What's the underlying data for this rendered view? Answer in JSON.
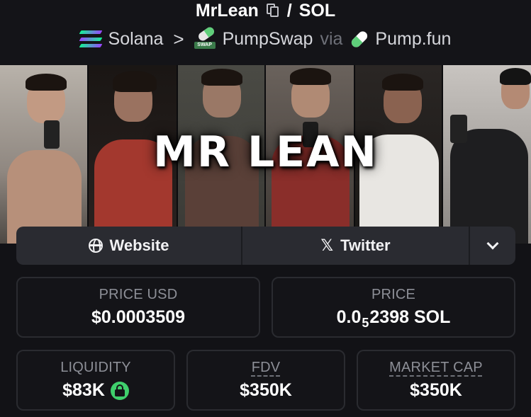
{
  "header": {
    "token_name": "MrLean",
    "separator": "/",
    "quote": "SOL",
    "chain": "Solana",
    "breadcrumb_sep": ">",
    "dex": "PumpSwap",
    "dex_badge": "SWAP",
    "via": "via",
    "launchpad": "Pump.fun",
    "icons": [
      "copy-icon",
      "solana-icon",
      "pumpswap-icon",
      "pumpfun-icon"
    ]
  },
  "banner": {
    "title": "MR LEAN"
  },
  "links": {
    "website": "Website",
    "twitter": "Twitter",
    "icons": [
      "globe-icon",
      "x-icon",
      "chevron-down-icon"
    ]
  },
  "stats": {
    "price_usd": {
      "label": "PRICE USD",
      "value": "$0.0003509"
    },
    "price": {
      "label": "PRICE",
      "value_main": "0.0",
      "value_sub": "5",
      "value_rest": "2398 SOL"
    },
    "liquidity": {
      "label": "LIQUIDITY",
      "value": "$83K"
    },
    "fdv": {
      "label": "FDV",
      "value": "$350K"
    },
    "market_cap": {
      "label": "MARKET CAP",
      "value": "$350K"
    }
  },
  "colors": {
    "background": "#121216",
    "card_border": "#2a2b30",
    "button_bg": "#2a2b31",
    "label": "#8d8f97",
    "lock_green": "#3fcf6c"
  }
}
